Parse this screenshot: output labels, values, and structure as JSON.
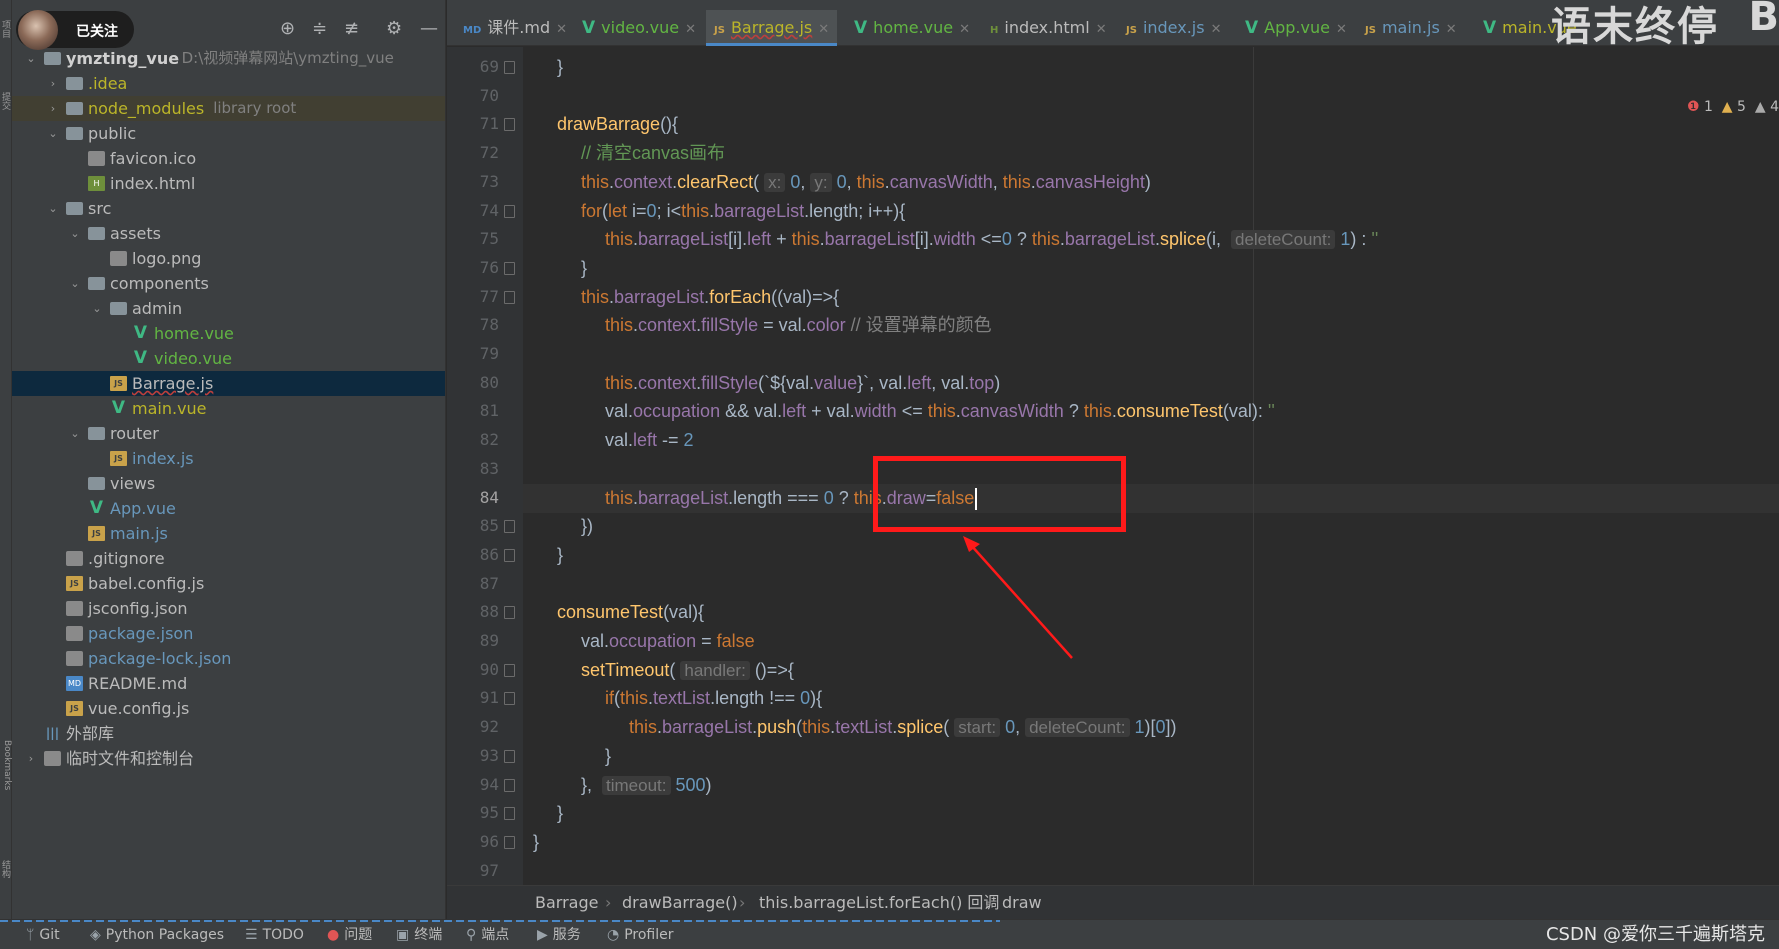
{
  "left_stripe": {
    "labels": [
      "项目",
      "提交",
      "Bookmarks",
      "结构"
    ]
  },
  "tree_header": {
    "follow_label": "已关注",
    "icons": [
      "crosshair-icon",
      "expand-all-icon",
      "collapse-all-icon",
      "gear-icon",
      "minimize-icon"
    ]
  },
  "tree": [
    {
      "label": "ymzting_vue",
      "path": "D:\\视频弹幕网站\\ymzting_vue",
      "icon": "folder",
      "arrow": "down"
    },
    {
      "label": ".idea",
      "icon": "folder",
      "arrow": "right"
    },
    {
      "label": "node_modules",
      "path": "library root",
      "icon": "folder",
      "arrow": "right"
    },
    {
      "label": "public",
      "icon": "folder",
      "arrow": "down"
    },
    {
      "label": "favicon.ico",
      "icon": "file"
    },
    {
      "label": "index.html",
      "icon": "html"
    },
    {
      "label": "src",
      "icon": "folder",
      "arrow": "down"
    },
    {
      "label": "assets",
      "icon": "folder",
      "arrow": "down"
    },
    {
      "label": "logo.png",
      "icon": "image"
    },
    {
      "label": "components",
      "icon": "folder",
      "arrow": "down"
    },
    {
      "label": "admin",
      "icon": "folder",
      "arrow": "down"
    },
    {
      "label": "home.vue",
      "icon": "vue"
    },
    {
      "label": "video.vue",
      "icon": "vue"
    },
    {
      "label": "Barrage.js",
      "icon": "js"
    },
    {
      "label": "main.vue",
      "icon": "vue"
    },
    {
      "label": "router",
      "icon": "folder",
      "arrow": "down"
    },
    {
      "label": "index.js",
      "icon": "js"
    },
    {
      "label": "views",
      "icon": "folder"
    },
    {
      "label": "App.vue",
      "icon": "vue"
    },
    {
      "label": "main.js",
      "icon": "js"
    },
    {
      "label": ".gitignore",
      "icon": "config"
    },
    {
      "label": "babel.config.js",
      "icon": "js"
    },
    {
      "label": "jsconfig.json",
      "icon": "config"
    },
    {
      "label": "package.json",
      "icon": "config"
    },
    {
      "label": "package-lock.json",
      "icon": "config"
    },
    {
      "label": "README.md",
      "icon": "md"
    },
    {
      "label": "vue.config.js",
      "icon": "js"
    },
    {
      "label": "外部库",
      "icon": "library"
    },
    {
      "label": "临时文件和控制台",
      "icon": "scratch",
      "arrow": "right"
    }
  ],
  "tabs": [
    {
      "label": "课件.md",
      "icon": "md"
    },
    {
      "label": "video.vue",
      "icon": "vue"
    },
    {
      "label": "Barrage.js",
      "icon": "js",
      "active": true
    },
    {
      "label": "home.vue",
      "icon": "vue"
    },
    {
      "label": "index.html",
      "icon": "html"
    },
    {
      "label": "index.js",
      "icon": "js"
    },
    {
      "label": "App.vue",
      "icon": "vue"
    },
    {
      "label": "main.js",
      "icon": "js"
    },
    {
      "label": "main.vue",
      "icon": "vue"
    }
  ],
  "watermark": {
    "text": "语末终停",
    "letter": "B"
  },
  "inspections": {
    "errors": "1",
    "warnings": "5",
    "more": "4"
  },
  "editor": {
    "current_line": 84,
    "lines": [
      {
        "n": 69,
        "tokens": [
          [
            "}",
            "plain"
          ]
        ],
        "indent": 1
      },
      {
        "n": 70,
        "tokens": [],
        "indent": 0
      },
      {
        "n": 71,
        "tokens": [
          [
            "drawBarrage",
            "fn"
          ],
          [
            "(){",
            "plain"
          ]
        ],
        "indent": 1
      },
      {
        "n": 72,
        "tokens": [
          [
            "// 清空canvas画布",
            "cmt"
          ]
        ],
        "indent": 2
      },
      {
        "n": 73,
        "tokens": [
          [
            "this",
            "this"
          ],
          [
            ".",
            "plain"
          ],
          [
            "context",
            "prop"
          ],
          [
            ".",
            "plain"
          ],
          [
            "clearRect",
            "fn"
          ],
          [
            "( ",
            "plain"
          ],
          [
            "x:",
            "hint"
          ],
          [
            " 0",
            "num"
          ],
          [
            ", ",
            "plain"
          ],
          [
            "y:",
            "hint"
          ],
          [
            " 0",
            "num"
          ],
          [
            ", ",
            "plain"
          ],
          [
            "this",
            "this"
          ],
          [
            ".",
            "plain"
          ],
          [
            "canvasWidth",
            "prop"
          ],
          [
            ", ",
            "plain"
          ],
          [
            "this",
            "this"
          ],
          [
            ".",
            "plain"
          ],
          [
            "canvasHeight",
            "prop"
          ],
          [
            ")",
            "plain"
          ]
        ],
        "indent": 2
      },
      {
        "n": 74,
        "tokens": [
          [
            "for",
            "kw"
          ],
          [
            "(",
            "plain"
          ],
          [
            "let",
            "kw"
          ],
          [
            " i=",
            "plain"
          ],
          [
            "0",
            "num"
          ],
          [
            "; i<",
            "plain"
          ],
          [
            "this",
            "this"
          ],
          [
            ".",
            "plain"
          ],
          [
            "barrageList",
            "prop"
          ],
          [
            ".length; i++){",
            "plain"
          ]
        ],
        "indent": 2
      },
      {
        "n": 75,
        "tokens": [
          [
            "this",
            "this"
          ],
          [
            ".",
            "plain"
          ],
          [
            "barrageList",
            "prop"
          ],
          [
            "[i].",
            "plain"
          ],
          [
            "left",
            "prop"
          ],
          [
            " + ",
            "plain"
          ],
          [
            "this",
            "this"
          ],
          [
            ".",
            "plain"
          ],
          [
            "barrageList",
            "prop"
          ],
          [
            "[i].",
            "plain"
          ],
          [
            "width",
            "prop"
          ],
          [
            " <=",
            "plain"
          ],
          [
            "0",
            "num"
          ],
          [
            " ? ",
            "plain"
          ],
          [
            "this",
            "this"
          ],
          [
            ".",
            "plain"
          ],
          [
            "barrageList",
            "prop"
          ],
          [
            ".",
            "plain"
          ],
          [
            "splice",
            "fn"
          ],
          [
            "(i,  ",
            "plain"
          ],
          [
            "deleteCount:",
            "hint"
          ],
          [
            " 1",
            "num"
          ],
          [
            ") : ",
            "plain"
          ],
          [
            "''",
            "str"
          ]
        ],
        "indent": 3
      },
      {
        "n": 76,
        "tokens": [
          [
            "}",
            "plain"
          ]
        ],
        "indent": 2
      },
      {
        "n": 77,
        "tokens": [
          [
            "this",
            "this"
          ],
          [
            ".",
            "plain"
          ],
          [
            "barrageList",
            "prop"
          ],
          [
            ".",
            "plain"
          ],
          [
            "forEach",
            "fn"
          ],
          [
            "((val)=>{",
            "plain"
          ]
        ],
        "indent": 2
      },
      {
        "n": 78,
        "tokens": [
          [
            "this",
            "this"
          ],
          [
            ".",
            "plain"
          ],
          [
            "context",
            "prop"
          ],
          [
            ".",
            "plain"
          ],
          [
            "fillStyle",
            "prop"
          ],
          [
            " = val.",
            "plain"
          ],
          [
            "color",
            "prop"
          ],
          [
            " // 设置弹幕的颜色",
            "cm"
          ]
        ],
        "indent": 3
      },
      {
        "n": 79,
        "tokens": [],
        "indent": 0
      },
      {
        "n": 80,
        "tokens": [
          [
            "this",
            "this"
          ],
          [
            ".",
            "plain"
          ],
          [
            "context",
            "prop"
          ],
          [
            ".",
            "plain"
          ],
          [
            "fillStyle",
            "prop"
          ],
          [
            "(`${val.",
            "plain"
          ],
          [
            "value",
            "prop"
          ],
          [
            "}`, val.",
            "plain"
          ],
          [
            "left",
            "prop"
          ],
          [
            ", val.",
            "plain"
          ],
          [
            "top",
            "prop"
          ],
          [
            ")",
            "plain"
          ]
        ],
        "indent": 3
      },
      {
        "n": 81,
        "tokens": [
          [
            "val.",
            "plain"
          ],
          [
            "occupation",
            "prop"
          ],
          [
            " && val.",
            "plain"
          ],
          [
            "left",
            "prop"
          ],
          [
            " + val.",
            "plain"
          ],
          [
            "width",
            "prop"
          ],
          [
            " <= ",
            "plain"
          ],
          [
            "this",
            "this"
          ],
          [
            ".",
            "plain"
          ],
          [
            "canvasWidth",
            "prop"
          ],
          [
            " ? ",
            "plain"
          ],
          [
            "this",
            "this"
          ],
          [
            ".",
            "plain"
          ],
          [
            "consumeTest",
            "fn"
          ],
          [
            "(val): ",
            "plain"
          ],
          [
            "''",
            "str"
          ]
        ],
        "indent": 3
      },
      {
        "n": 82,
        "tokens": [
          [
            "val.",
            "plain"
          ],
          [
            "left",
            "prop"
          ],
          [
            " -= ",
            "plain"
          ],
          [
            "2",
            "num"
          ]
        ],
        "indent": 3
      },
      {
        "n": 83,
        "tokens": [],
        "indent": 0
      },
      {
        "n": 84,
        "tokens": [
          [
            "this",
            "this"
          ],
          [
            ".",
            "plain"
          ],
          [
            "barrageList",
            "prop"
          ],
          [
            ".length === ",
            "plain"
          ],
          [
            "0",
            "num"
          ],
          [
            " ? ",
            "plain"
          ],
          [
            "this",
            "this"
          ],
          [
            ".",
            "plain"
          ],
          [
            "draw",
            "prop"
          ],
          [
            "=",
            "plain"
          ],
          [
            "false",
            "kw"
          ]
        ],
        "indent": 3
      },
      {
        "n": 85,
        "tokens": [
          [
            "})",
            "plain"
          ]
        ],
        "indent": 2
      },
      {
        "n": 86,
        "tokens": [
          [
            "}",
            "plain"
          ]
        ],
        "indent": 1
      },
      {
        "n": 87,
        "tokens": [],
        "indent": 0
      },
      {
        "n": 88,
        "tokens": [
          [
            "consumeTest",
            "fn"
          ],
          [
            "(val){",
            "plain"
          ]
        ],
        "indent": 1
      },
      {
        "n": 89,
        "tokens": [
          [
            "val.",
            "plain"
          ],
          [
            "occupation",
            "prop"
          ],
          [
            " = ",
            "plain"
          ],
          [
            "false",
            "kw"
          ]
        ],
        "indent": 2
      },
      {
        "n": 90,
        "tokens": [
          [
            "setTimeout",
            "fn"
          ],
          [
            "( ",
            "plain"
          ],
          [
            "handler:",
            "hint"
          ],
          [
            " ()=>{",
            "plain"
          ]
        ],
        "indent": 2
      },
      {
        "n": 91,
        "tokens": [
          [
            "if",
            "kw"
          ],
          [
            "(",
            "plain"
          ],
          [
            "this",
            "this"
          ],
          [
            ".",
            "plain"
          ],
          [
            "textList",
            "prop"
          ],
          [
            ".length !== ",
            "plain"
          ],
          [
            "0",
            "num"
          ],
          [
            "){",
            "plain"
          ]
        ],
        "indent": 3
      },
      {
        "n": 92,
        "tokens": [
          [
            "this",
            "this"
          ],
          [
            ".",
            "plain"
          ],
          [
            "barrageList",
            "prop"
          ],
          [
            ".",
            "plain"
          ],
          [
            "push",
            "fn"
          ],
          [
            "(",
            "plain"
          ],
          [
            "this",
            "this"
          ],
          [
            ".",
            "plain"
          ],
          [
            "textList",
            "prop"
          ],
          [
            ".",
            "plain"
          ],
          [
            "splice",
            "fn"
          ],
          [
            "( ",
            "plain"
          ],
          [
            "start:",
            "hint"
          ],
          [
            " 0",
            "num"
          ],
          [
            ", ",
            "plain"
          ],
          [
            "deleteCount:",
            "hint"
          ],
          [
            " 1",
            "num"
          ],
          [
            ")[",
            "plain"
          ],
          [
            "0",
            "num"
          ],
          [
            "])",
            "plain"
          ]
        ],
        "indent": 4
      },
      {
        "n": 93,
        "tokens": [
          [
            "}",
            "plain"
          ]
        ],
        "indent": 3
      },
      {
        "n": 94,
        "tokens": [
          [
            "},  ",
            "plain"
          ],
          [
            "timeout:",
            "hint"
          ],
          [
            " 500",
            "num"
          ],
          [
            ")",
            "plain"
          ]
        ],
        "indent": 2
      },
      {
        "n": 95,
        "tokens": [
          [
            "}",
            "plain"
          ]
        ],
        "indent": 1
      },
      {
        "n": 96,
        "tokens": [
          [
            "}",
            "plain"
          ]
        ],
        "indent": 0
      },
      {
        "n": 97,
        "tokens": [],
        "indent": 0
      }
    ]
  },
  "breadcrumbs": [
    "Barrage",
    "drawBarrage()",
    "this.barrageList.forEach() 回调",
    "draw"
  ],
  "status_bar": [
    {
      "label": "Git",
      "icon": "git-icon"
    },
    {
      "label": "Python Packages",
      "icon": "packages-icon"
    },
    {
      "label": "TODO",
      "icon": "todo-icon"
    },
    {
      "label": "问题",
      "icon": "problems-icon"
    },
    {
      "label": "终端",
      "icon": "terminal-icon"
    },
    {
      "label": "端点",
      "icon": "endpoints-icon"
    },
    {
      "label": "服务",
      "icon": "services-icon"
    },
    {
      "label": "Profiler",
      "icon": "profiler-icon"
    }
  ],
  "csdn_watermark": "CSDN @爱你三千遍斯塔克",
  "colors": {
    "highlight_box": "#ff1a1a",
    "arrow": "#ff1a1a",
    "selection": "#0d293e"
  }
}
